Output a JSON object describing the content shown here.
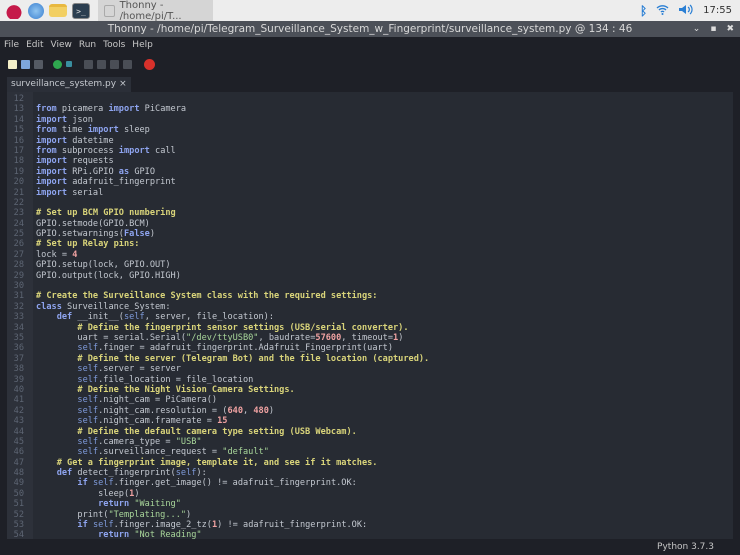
{
  "taskbar": {
    "window_label": "Thonny - /home/pi/T...",
    "clock": "17:55",
    "icons": [
      "raspberry-pi-menu-icon",
      "web-browser-icon",
      "file-manager-icon",
      "terminal-icon",
      "bluetooth-icon",
      "wifi-icon",
      "volume-icon"
    ]
  },
  "window": {
    "title": "Thonny  -  /home/pi/Telegram_Surveillance_System_w_Fingerprint/surveillance_system.py  @  134 : 46"
  },
  "menu": [
    "File",
    "Edit",
    "View",
    "Run",
    "Tools",
    "Help"
  ],
  "toolbar": [
    "new",
    "open",
    "save",
    "run",
    "debug",
    "step-over",
    "step-into",
    "step-out",
    "resume",
    "stop"
  ],
  "tab": {
    "label": "surveillance_system.py",
    "close": "×"
  },
  "colors": {
    "keyword": "#8ea4ef",
    "comment": "#d9d47a",
    "string": "#a8d69a",
    "number": "#f0a2a2",
    "self": "#7f9bdb",
    "background": "#272b33"
  },
  "code": [
    {
      "n": "12",
      "t": []
    },
    {
      "n": "13",
      "t": [
        [
          "k",
          "from"
        ],
        [
          "t",
          " picamera "
        ],
        [
          "k",
          "import"
        ],
        [
          "t",
          " PiCamera"
        ]
      ]
    },
    {
      "n": "14",
      "t": [
        [
          "k",
          "import"
        ],
        [
          "t",
          " json"
        ]
      ]
    },
    {
      "n": "15",
      "t": [
        [
          "k",
          "from"
        ],
        [
          "t",
          " time "
        ],
        [
          "k",
          "import"
        ],
        [
          "t",
          " sleep"
        ]
      ]
    },
    {
      "n": "16",
      "t": [
        [
          "k",
          "import"
        ],
        [
          "t",
          " datetime"
        ]
      ]
    },
    {
      "n": "17",
      "t": [
        [
          "k",
          "from"
        ],
        [
          "t",
          " subprocess "
        ],
        [
          "k",
          "import"
        ],
        [
          "t",
          " call"
        ]
      ]
    },
    {
      "n": "18",
      "t": [
        [
          "k",
          "import"
        ],
        [
          "t",
          " requests"
        ]
      ]
    },
    {
      "n": "19",
      "t": [
        [
          "k",
          "import"
        ],
        [
          "t",
          " RPi.GPIO "
        ],
        [
          "k",
          "as"
        ],
        [
          "t",
          " GPIO"
        ]
      ]
    },
    {
      "n": "20",
      "t": [
        [
          "k",
          "import"
        ],
        [
          "t",
          " adafruit_fingerprint"
        ]
      ]
    },
    {
      "n": "21",
      "t": [
        [
          "k",
          "import"
        ],
        [
          "t",
          " serial"
        ]
      ]
    },
    {
      "n": "22",
      "t": []
    },
    {
      "n": "23",
      "t": [
        [
          "c",
          "# Set up BCM GPIO numbering"
        ]
      ]
    },
    {
      "n": "24",
      "t": [
        [
          "t",
          "GPIO.setmode(GPIO.BCM)"
        ]
      ]
    },
    {
      "n": "25",
      "t": [
        [
          "t",
          "GPIO.setwarnings("
        ],
        [
          "k",
          "False"
        ],
        [
          "t",
          ")"
        ]
      ]
    },
    {
      "n": "26",
      "t": [
        [
          "c",
          "# Set up Relay pins:"
        ]
      ]
    },
    {
      "n": "27",
      "t": [
        [
          "t",
          "lock = "
        ],
        [
          "n",
          "4"
        ]
      ]
    },
    {
      "n": "28",
      "t": [
        [
          "t",
          "GPIO.setup(lock, GPIO.OUT)"
        ]
      ]
    },
    {
      "n": "29",
      "t": [
        [
          "t",
          "GPIO.output(lock, GPIO.HIGH)"
        ]
      ]
    },
    {
      "n": "30",
      "t": []
    },
    {
      "n": "31",
      "t": [
        [
          "c",
          "# Create the Surveillance System class with the required settings:"
        ]
      ]
    },
    {
      "n": "32",
      "t": [
        [
          "k",
          "class"
        ],
        [
          "t",
          " Surveillance_System:"
        ]
      ]
    },
    {
      "n": "33",
      "t": [
        [
          "t",
          "    "
        ],
        [
          "k",
          "def"
        ],
        [
          "t",
          " __init__("
        ],
        [
          "f",
          "self"
        ],
        [
          "t",
          ", server, file_location):"
        ]
      ]
    },
    {
      "n": "34",
      "t": [
        [
          "t",
          "        "
        ],
        [
          "c",
          "# Define the fingerprint sensor settings (USB/serial converter)."
        ]
      ]
    },
    {
      "n": "35",
      "t": [
        [
          "t",
          "        uart = serial.Serial("
        ],
        [
          "s",
          "\"/dev/ttyUSB0\""
        ],
        [
          "t",
          ", baudrate="
        ],
        [
          "n",
          "57600"
        ],
        [
          "t",
          ", timeout="
        ],
        [
          "n",
          "1"
        ],
        [
          "t",
          ")"
        ]
      ]
    },
    {
      "n": "36",
      "t": [
        [
          "t",
          "        "
        ],
        [
          "f",
          "self"
        ],
        [
          "t",
          ".finger = adafruit_fingerprint.Adafruit_Fingerprint(uart)"
        ]
      ]
    },
    {
      "n": "37",
      "t": [
        [
          "t",
          "        "
        ],
        [
          "c",
          "# Define the server (Telegram Bot) and the file location (captured)."
        ]
      ]
    },
    {
      "n": "38",
      "t": [
        [
          "t",
          "        "
        ],
        [
          "f",
          "self"
        ],
        [
          "t",
          ".server = server"
        ]
      ]
    },
    {
      "n": "39",
      "t": [
        [
          "t",
          "        "
        ],
        [
          "f",
          "self"
        ],
        [
          "t",
          ".file_location = file_location"
        ]
      ]
    },
    {
      "n": "40",
      "t": [
        [
          "t",
          "        "
        ],
        [
          "c",
          "# Define the Night Vision Camera Settings."
        ]
      ]
    },
    {
      "n": "41",
      "t": [
        [
          "t",
          "        "
        ],
        [
          "f",
          "self"
        ],
        [
          "t",
          ".night_cam = PiCamera()"
        ]
      ]
    },
    {
      "n": "42",
      "t": [
        [
          "t",
          "        "
        ],
        [
          "f",
          "self"
        ],
        [
          "t",
          ".night_cam.resolution = ("
        ],
        [
          "n",
          "640"
        ],
        [
          "t",
          ", "
        ],
        [
          "n",
          "480"
        ],
        [
          "t",
          ")"
        ]
      ]
    },
    {
      "n": "43",
      "t": [
        [
          "t",
          "        "
        ],
        [
          "f",
          "self"
        ],
        [
          "t",
          ".night_cam.framerate = "
        ],
        [
          "n",
          "15"
        ]
      ]
    },
    {
      "n": "44",
      "t": [
        [
          "t",
          "        "
        ],
        [
          "c",
          "# Define the default camera type setting (USB Webcam)."
        ]
      ]
    },
    {
      "n": "45",
      "t": [
        [
          "t",
          "        "
        ],
        [
          "f",
          "self"
        ],
        [
          "t",
          ".camera_type = "
        ],
        [
          "s",
          "\"USB\""
        ]
      ]
    },
    {
      "n": "46",
      "t": [
        [
          "t",
          "        "
        ],
        [
          "f",
          "self"
        ],
        [
          "t",
          ".surveillance_request = "
        ],
        [
          "s",
          "\"default\""
        ]
      ]
    },
    {
      "n": "47",
      "t": [
        [
          "t",
          "    "
        ],
        [
          "c",
          "# Get a fingerprint image, template it, and see if it matches."
        ]
      ]
    },
    {
      "n": "48",
      "t": [
        [
          "t",
          "    "
        ],
        [
          "k",
          "def"
        ],
        [
          "t",
          " detect_fingerprint("
        ],
        [
          "f",
          "self"
        ],
        [
          "t",
          "):"
        ]
      ]
    },
    {
      "n": "49",
      "t": [
        [
          "t",
          "        "
        ],
        [
          "k",
          "if"
        ],
        [
          "t",
          " "
        ],
        [
          "f",
          "self"
        ],
        [
          "t",
          ".finger.get_image() != adafruit_fingerprint.OK:"
        ]
      ]
    },
    {
      "n": "50",
      "t": [
        [
          "t",
          "            sleep("
        ],
        [
          "n",
          "1"
        ],
        [
          "t",
          ")"
        ]
      ]
    },
    {
      "n": "51",
      "t": [
        [
          "t",
          "            "
        ],
        [
          "k",
          "return"
        ],
        [
          "t",
          " "
        ],
        [
          "s",
          "\"Waiting\""
        ]
      ]
    },
    {
      "n": "52",
      "t": [
        [
          "t",
          "        print("
        ],
        [
          "s",
          "\"Templating...\""
        ],
        [
          "t",
          ")"
        ]
      ]
    },
    {
      "n": "53",
      "t": [
        [
          "t",
          "        "
        ],
        [
          "k",
          "if"
        ],
        [
          "t",
          " "
        ],
        [
          "f",
          "self"
        ],
        [
          "t",
          ".finger.image_2_tz("
        ],
        [
          "n",
          "1"
        ],
        [
          "t",
          ") != adafruit_fingerprint.OK:"
        ]
      ]
    },
    {
      "n": "54",
      "t": [
        [
          "t",
          "            "
        ],
        [
          "k",
          "return"
        ],
        [
          "t",
          " "
        ],
        [
          "s",
          "\"Not Reading\""
        ]
      ]
    }
  ],
  "status": {
    "interpreter": "Python 3.7.3"
  }
}
